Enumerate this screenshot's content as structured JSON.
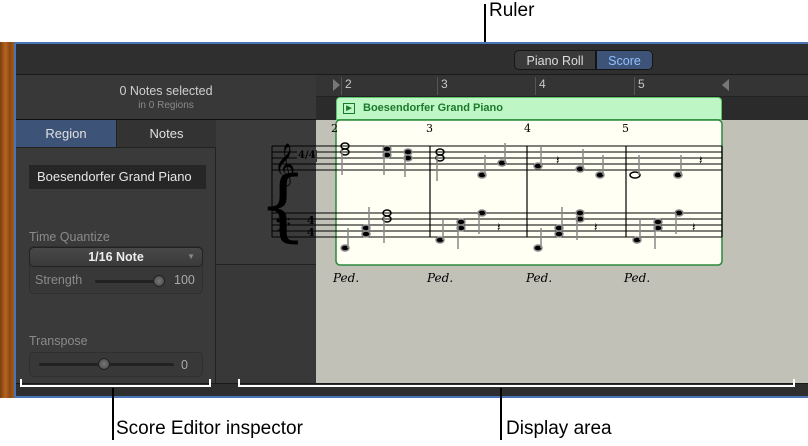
{
  "callouts": {
    "ruler": "Ruler",
    "inspector": "Score Editor inspector",
    "display": "Display area"
  },
  "toolbar": {
    "piano_roll": "Piano Roll",
    "score": "Score"
  },
  "selection": {
    "title": "0 Notes selected",
    "subtitle": "in 0 Regions"
  },
  "ruler": {
    "bars": [
      "2",
      "3",
      "4",
      "5"
    ]
  },
  "region": {
    "name": "Boesendorfer Grand Piano",
    "color": "#bff6c6"
  },
  "tabs": {
    "region": "Region",
    "notes": "Notes"
  },
  "inspector": {
    "region_name": "Boesendorfer Grand Piano",
    "time_quantize_label": "Time Quantize",
    "time_quantize_value": "1/16 Note",
    "strength_label": "Strength",
    "strength_value": "100",
    "transpose_label": "Transpose",
    "transpose_value": "0"
  },
  "score": {
    "measures": [
      "2",
      "3",
      "4",
      "5"
    ],
    "time_signature": "4/4",
    "pedal": [
      "Ped.",
      "Ped.",
      "Ped.",
      "Ped."
    ]
  }
}
